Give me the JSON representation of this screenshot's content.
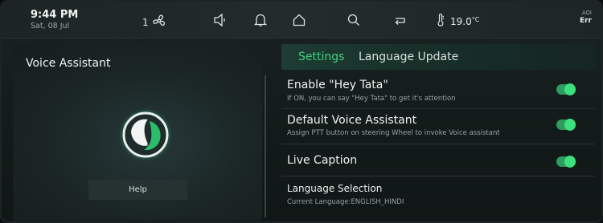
{
  "status_bar": {
    "time": "9:44 PM",
    "date": "Sat, 08 Jul",
    "fan_level": "1",
    "temperature": "19.0",
    "temperature_unit": "°C",
    "aqi_label": "AQI",
    "aqi_value": "Err",
    "icons": [
      "fan-icon",
      "volume-icon",
      "bell-icon",
      "home-icon",
      "search-icon",
      "return-icon",
      "thermometer-icon"
    ]
  },
  "left_panel": {
    "title": "Voice Assistant",
    "help_label": "Help"
  },
  "tabs": [
    {
      "label": "Settings",
      "active": true
    },
    {
      "label": "Language Update",
      "active": false
    }
  ],
  "settings": [
    {
      "title": "Enable \"Hey Tata\"",
      "subtitle": "If ON, you can say \"Hey Tata\" to get it's attention",
      "toggle": true
    },
    {
      "title": "Default Voice Assistant",
      "subtitle": "Assign PTT button on steering Wheel to invoke Voice assistant",
      "toggle": true
    },
    {
      "title": "Live Caption",
      "subtitle": "",
      "toggle": true
    },
    {
      "title": "Language Selection",
      "subtitle": "Current Language:ENGLISH_HINDI"
    }
  ],
  "colors": {
    "accent": "#3fd07f",
    "toggle_on": "#3ce07c",
    "background": "#131b1a"
  }
}
